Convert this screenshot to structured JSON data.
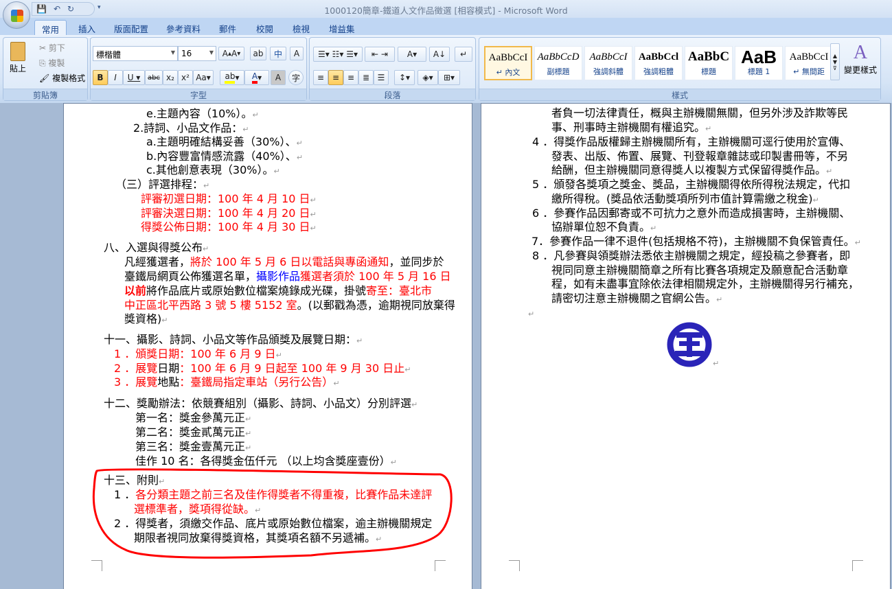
{
  "window": {
    "title": "1000120簡章-鐵道人文作品徵選 [相容模式] - Microsoft Word"
  },
  "tabs": [
    "常用",
    "插入",
    "版面配置",
    "參考資料",
    "郵件",
    "校閱",
    "檢視",
    "增益集"
  ],
  "clipboard": {
    "paste": "貼上",
    "cut": "剪下",
    "copy": "複製",
    "format_painter": "複製格式",
    "label": "剪貼簿"
  },
  "font": {
    "name": "標楷體",
    "size": "16",
    "label": "字型"
  },
  "paragraph": {
    "label": "段落"
  },
  "styles": {
    "label": "樣式",
    "change_styles": "變更樣式",
    "items": [
      {
        "sample": "AaBbCcI",
        "name": "↵ 內文"
      },
      {
        "sample": "AaBbCcD",
        "name": "副標題"
      },
      {
        "sample": "AaBbCcI",
        "name": "強調斜體"
      },
      {
        "sample": "AaBbCcl",
        "name": "強調粗體"
      },
      {
        "sample": "AaBbC",
        "name": "標題"
      },
      {
        "sample": "AaB",
        "name": "標題 1"
      },
      {
        "sample": "AaBbCcI",
        "name": "↵ 無間距"
      }
    ]
  },
  "colors": {
    "highlight": "#ffff00",
    "font_color": "#ff0000",
    "accent": "#f00",
    "logo": "#2a24b8"
  },
  "left_page": [
    [
      [
        "e.主題內容（10%）。",
        ""
      ]
    ],
    [
      [
        "2.詩詞、小品文作品：",
        ""
      ]
    ],
    [
      [
        "a.主題明確結構妥善（30%）、",
        ""
      ]
    ],
    [
      [
        "b.內容豐富情感流露（40%）、",
        ""
      ]
    ],
    [
      [
        "c.其他創意表現（30%）。",
        ""
      ]
    ],
    [
      [
        "（三）評選排程：",
        ""
      ]
    ],
    [
      [
        "評審初選日期：100 年 4 月 10 日",
        "r"
      ]
    ],
    [
      [
        "評審決選日期：100 年 4 月 20 日",
        "r"
      ]
    ],
    [
      [
        "得獎公佈日期：100 年 4 月 30 日",
        "r"
      ]
    ],
    [
      [
        "八、入選與得獎公布",
        ""
      ]
    ],
    [
      [
        "凡經獲選者，",
        ""
      ],
      [
        "將於 100 年 5 月 6 日以電話與專函通知",
        "r"
      ],
      [
        "，並同步於",
        ""
      ]
    ],
    [
      [
        "臺鐵局網頁公佈獲選名單，",
        ""
      ],
      [
        "攝影作品",
        "b"
      ],
      [
        "獲選者須於 100 年 5 月 16 日",
        "r"
      ]
    ],
    [
      [
        "以前",
        "r bold"
      ],
      [
        "將作品底片或原始數位檔案燒錄成光碟，掛號",
        ""
      ],
      [
        "寄至：臺北市",
        "r"
      ]
    ],
    [
      [
        "中正區北平西路 3 號 5 樓 5152 室",
        "r"
      ],
      [
        "。(以郵戳為憑，逾期視同放棄得",
        ""
      ]
    ],
    [
      [
        "獎資格)",
        ""
      ]
    ],
    [
      [
        "十一、攝影、詩詞、小品文等作品頒獎及展覽日期：",
        ""
      ]
    ],
    [
      [
        "1 ．頒獎日期：100 年 6 月 9 日",
        "r"
      ]
    ],
    [
      [
        "2 ．展覽",
        "r"
      ],
      [
        "日期",
        ""
      ],
      [
        "：100 年 6 月 9 日起至 100 年 9 月 30 日止",
        "r"
      ]
    ],
    [
      [
        "3 ．展覽",
        "r"
      ],
      [
        "地點",
        ""
      ],
      [
        "：臺鐵局指定車站（另行公告）",
        "r"
      ]
    ],
    [
      [
        "十二、獎勵辦法：依競賽組別（攝影、詩詞、小品文）分別評選",
        ""
      ]
    ],
    [
      [
        "第一名：獎金參萬元正",
        ""
      ]
    ],
    [
      [
        "第二名：獎金貳萬元正",
        ""
      ]
    ],
    [
      [
        "第三名：獎金壹萬元正",
        ""
      ]
    ],
    [
      [
        "佳作 10 名：各得獎金伍仟元 （以上均含獎座壹份）",
        ""
      ]
    ],
    [
      [
        "十三、附則",
        ""
      ]
    ],
    [
      [
        "1 ．",
        ""
      ],
      [
        "各分類主題之前三名及佳作得獎者不得重複，比賽作品未達評",
        "r"
      ]
    ],
    [
      [
        "選標準者，獎項得從缺。",
        "r"
      ]
    ],
    [
      [
        "2 ．得獎者，須繳交作品、底片或原始數位檔案，逾主辦機關規定",
        ""
      ]
    ],
    [
      [
        "期限者視同放棄得獎資格，其獎項名額不另遞補。",
        ""
      ]
    ]
  ],
  "right_page": [
    [
      [
        "者負一切法律責任，概與主辦機關無關，但另外涉及詐欺等民",
        ""
      ]
    ],
    [
      [
        "事、刑事時主辦機關有權追究。",
        ""
      ]
    ],
    [
      [
        "4 ．得獎作品版權歸主辦機關所有，主辦機關可逕行使用於宣傳、",
        ""
      ]
    ],
    [
      [
        "發表、出版、佈置、展覽、刊登報章雜誌或印製書冊等，不另",
        ""
      ]
    ],
    [
      [
        "給酬，但主辦機關同意得獎人以複製方式保留得獎作品。",
        ""
      ]
    ],
    [
      [
        "5 ．頒發各獎項之獎金、獎品，主辦機關得依所得稅法規定，代扣",
        ""
      ]
    ],
    [
      [
        "繳所得稅。(獎品依活動獎項所列市值計算需繳之稅金)",
        ""
      ]
    ],
    [
      [
        "6 ．參賽作品因郵寄或不可抗力之意外而造成損害時，主辦機關、",
        ""
      ]
    ],
    [
      [
        "協辦單位恕不負責。",
        ""
      ]
    ],
    [
      [
        "7．參賽作品一律不退件(包括規格不符)，主辦機關不負保管責任。",
        ""
      ]
    ],
    [
      [
        "8 ．凡參賽與領獎辦法悉依主辦機關之規定，經投稿之參賽者，即",
        ""
      ]
    ],
    [
      [
        "視同同意主辦機關簡章之所有比賽各項規定及願意配合活動章",
        ""
      ]
    ],
    [
      [
        "程，如有未盡事宜除依法律相關規定外，主辦機關得另行補充，",
        ""
      ]
    ],
    [
      [
        "請密切注意主辦機關之官網公告。",
        ""
      ]
    ]
  ]
}
